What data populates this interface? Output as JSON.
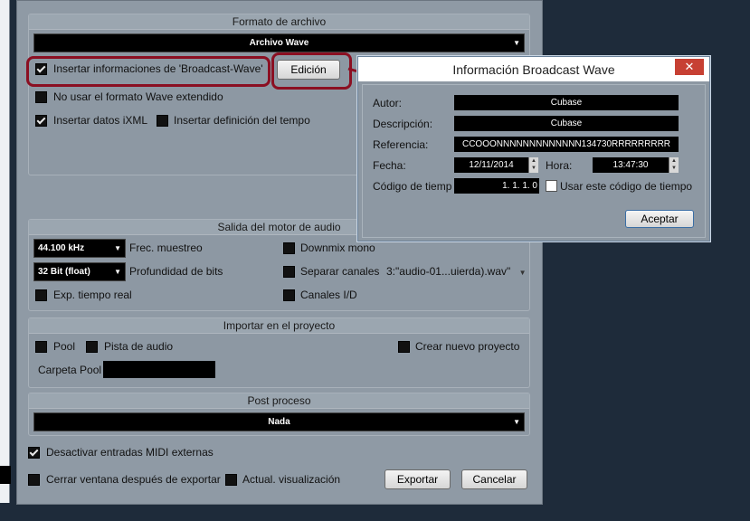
{
  "file_format": {
    "title": "Formato de archivo",
    "format_select": "Archivo Wave",
    "insert_bwf_label": "Insertar informaciones de 'Broadcast-Wave'",
    "edit_button": "Edición",
    "no_extended_wave_label": "No usar el formato Wave extendido",
    "insert_ixml_label": "Insertar datos iXML",
    "insert_tempo_label": "Insertar definición del tempo"
  },
  "engine_output": {
    "title": "Salida del motor de audio",
    "sample_rate_value": "44.100 kHz",
    "sample_rate_label": "Frec. muestreo",
    "bit_depth_value": "32 Bit (float)",
    "bit_depth_label": "Profundidad de bits",
    "realtime_label": "Exp. tiempo real",
    "downmix_label": "Downmix mono",
    "split_channels_label": "Separar canales",
    "split_file_value": "3:\"audio-01...uierda).wav\"",
    "channels_io_label": "Canales I/D"
  },
  "import_project": {
    "title": "Importar en el proyecto",
    "pool_label": "Pool",
    "audio_track_label": "Pista de audio",
    "new_project_label": "Crear nuevo proyecto",
    "pool_folder_label": "Carpeta Pool"
  },
  "post_process": {
    "title": "Post proceso",
    "value": "Nada"
  },
  "footer": {
    "disable_midi_label": "Desactivar entradas MIDI externas",
    "close_after_label": "Cerrar ventana después de exportar",
    "update_display_label": "Actual. visualización",
    "export_button": "Exportar",
    "cancel_button": "Cancelar"
  },
  "bwf_popup": {
    "title": "Información Broadcast Wave",
    "close_glyph": "✕",
    "author_label": "Autor:",
    "author_value": "Cubase",
    "description_label": "Descripción:",
    "description_value": "Cubase",
    "reference_label": "Referencia:",
    "reference_value": "CCOOONNNNNNNNNNNNN134730RRRRRRRRR",
    "date_label": "Fecha:",
    "date_value": "12/11/2014",
    "time_label": "Hora:",
    "time_value": "13:47:30",
    "timecode_label": "Código de tiemp",
    "timecode_value": "1.   1.   1.   0",
    "use_timecode_label": "Usar este código de tiempo",
    "accept_button": "Aceptar"
  },
  "colors": {
    "annotation_red": "#8b0f22",
    "panel_gray": "#8d98a3",
    "background_navy": "#1e2b3a"
  }
}
